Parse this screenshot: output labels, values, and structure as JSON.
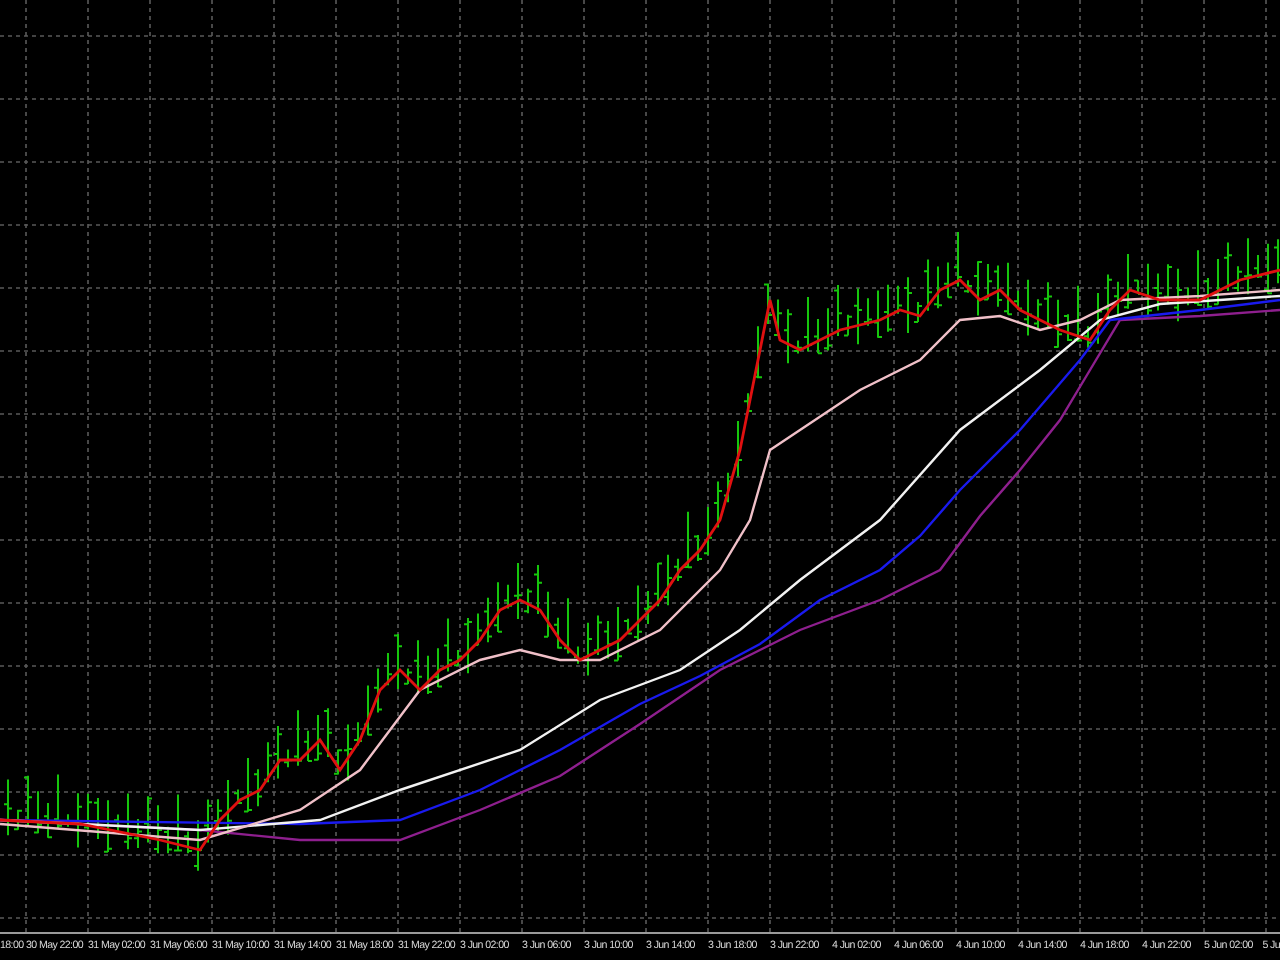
{
  "time_axis": {
    "labels": [
      "18:00",
      "30 May 22:00",
      "31 May 02:00",
      "31 May 06:00",
      "31 May 10:00",
      "31 May 14:00",
      "31 May 18:00",
      "31 May 22:00",
      "3 Jun 02:00",
      "3 Jun 06:00",
      "3 Jun 10:00",
      "3 Jun 14:00",
      "3 Jun 18:00",
      "3 Jun 22:00",
      "4 Jun 02:00",
      "4 Jun 06:00",
      "4 Jun 10:00",
      "4 Jun 14:00",
      "4 Jun 18:00",
      "4 Jun 22:00",
      "5 Jun 02:00",
      "5 Ju"
    ]
  }
}
